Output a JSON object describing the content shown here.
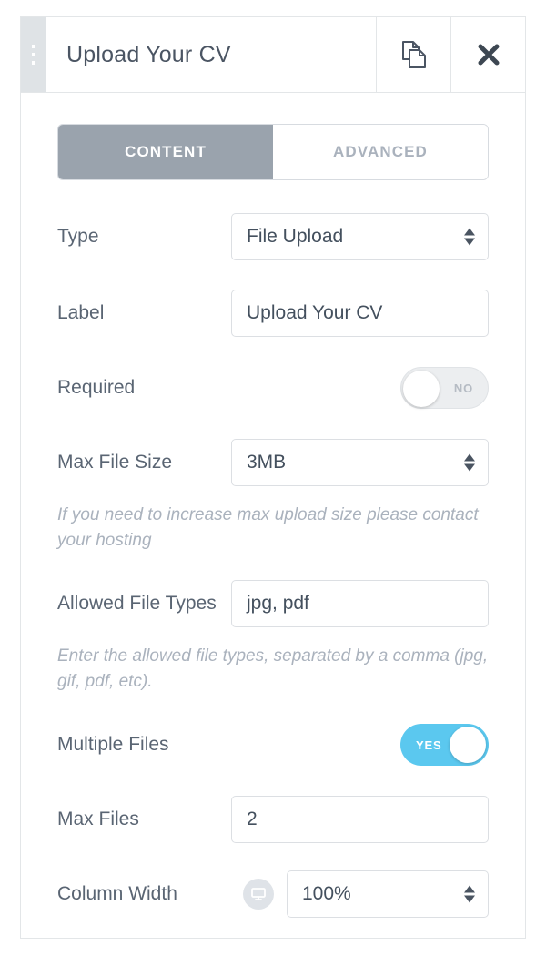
{
  "header": {
    "title": "Upload Your CV",
    "drag_handle_icon": "drag-dots-icon",
    "duplicate_icon": "duplicate-icon",
    "close_icon": "close-icon"
  },
  "tabs": [
    {
      "label": "CONTENT",
      "active": true
    },
    {
      "label": "ADVANCED",
      "active": false
    }
  ],
  "fields": {
    "type": {
      "label": "Type",
      "value": "File Upload",
      "control": "select"
    },
    "label": {
      "label": "Label",
      "value": "Upload Your CV",
      "placeholder": "",
      "control": "text"
    },
    "required": {
      "label": "Required",
      "state": "NO",
      "on": false,
      "control": "toggle"
    },
    "max_file_size": {
      "label": "Max File Size",
      "value": "3MB",
      "control": "select",
      "help": "If you need to increase max upload size please contact your hosting"
    },
    "allowed_file_types": {
      "label": "Allowed File Types",
      "value": "jpg, pdf",
      "placeholder": "",
      "control": "text",
      "help": "Enter the allowed file types, separated by a comma (jpg, gif, pdf, etc)."
    },
    "multiple_files": {
      "label": "Multiple Files",
      "state": "YES",
      "on": true,
      "control": "toggle"
    },
    "max_files": {
      "label": "Max Files",
      "value": "2",
      "placeholder": "",
      "control": "text"
    },
    "column_width": {
      "label": "Column Width",
      "value": "100%",
      "control": "select",
      "device_icon": "desktop-monitor-icon"
    }
  },
  "colors": {
    "toggle_on": "#5bc8ef",
    "tab_active_bg": "#9aa3ad",
    "label_text": "#5a6573",
    "helper_text": "#aab2bd",
    "input_text": "#44505e",
    "border": "#dcdfe3"
  }
}
